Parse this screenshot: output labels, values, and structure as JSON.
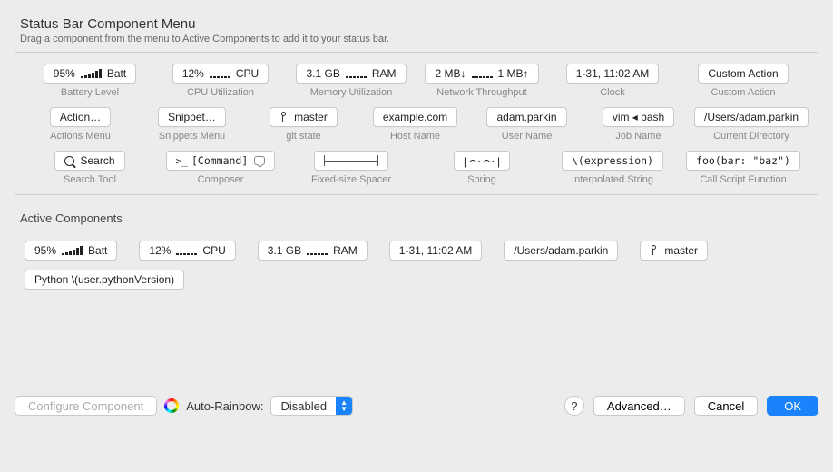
{
  "header": {
    "title": "Status Bar Component Menu",
    "subtitle": "Drag a component from the menu to Active Components to add it to your status bar."
  },
  "menu": [
    [
      {
        "name": "battery-level",
        "caption": "Battery Level",
        "pre": "95%",
        "post": "Batt",
        "bars": "asc"
      },
      {
        "name": "cpu-utilization",
        "caption": "CPU Utilization",
        "pre": "12%",
        "post": "CPU",
        "bars": "flat"
      },
      {
        "name": "memory-utilization",
        "caption": "Memory Utilization",
        "pre": "3.1 GB",
        "post": "RAM",
        "bars": "flat"
      },
      {
        "name": "network-throughput",
        "caption": "Network Throughput",
        "pre": "2 MB↓",
        "post": "1 MB↑",
        "bars": "flat"
      },
      {
        "name": "clock",
        "caption": "Clock",
        "text": "1-31, 11:02 AM"
      },
      {
        "name": "custom-action",
        "caption": "Custom Action",
        "text": "Custom Action"
      }
    ],
    [
      {
        "name": "actions-menu",
        "caption": "Actions Menu",
        "text": "Action…"
      },
      {
        "name": "snippets-menu",
        "caption": "Snippets Menu",
        "text": "Snippet…"
      },
      {
        "name": "git-state",
        "caption": "git state",
        "text": "master",
        "icon": "branch"
      },
      {
        "name": "host-name",
        "caption": "Host Name",
        "text": "example.com"
      },
      {
        "name": "user-name",
        "caption": "User Name",
        "text": "adam.parkin"
      },
      {
        "name": "job-name",
        "caption": "Job Name",
        "text": "vim ◂ bash"
      },
      {
        "name": "current-directory",
        "caption": "Current Directory",
        "text": "/Users/adam.parkin"
      }
    ],
    [
      {
        "name": "search-tool",
        "caption": "Search Tool",
        "text": "Search",
        "icon": "search"
      },
      {
        "name": "composer",
        "caption": "Composer",
        "text": "[Command]",
        "icon": "prompt",
        "trailingIcon": "bubble"
      },
      {
        "name": "fixed-size-spacer",
        "caption": "Fixed-size Spacer",
        "text": "",
        "icon": "spacer"
      },
      {
        "name": "spring",
        "caption": "Spring",
        "text": "|   ～ ～   |"
      },
      {
        "name": "interpolated-string",
        "caption": "Interpolated String",
        "text": "\\(expression)"
      },
      {
        "name": "call-script-function",
        "caption": "Call Script Function",
        "text": "foo(bar: \"baz\")"
      }
    ]
  ],
  "activeLabel": "Active Components",
  "active": [
    {
      "name": "battery-level",
      "pre": "95%",
      "post": "Batt",
      "bars": "asc"
    },
    {
      "name": "cpu-utilization",
      "pre": "12%",
      "post": "CPU",
      "bars": "flat"
    },
    {
      "name": "memory-utilization",
      "pre": "3.1 GB",
      "post": "RAM",
      "bars": "flat"
    },
    {
      "name": "clock",
      "text": "1-31, 11:02 AM"
    },
    {
      "name": "current-directory",
      "text": "/Users/adam.parkin"
    },
    {
      "name": "git-state",
      "text": "master",
      "icon": "branch"
    },
    {
      "name": "python-version",
      "text": "Python \\(user.pythonVersion)"
    }
  ],
  "footer": {
    "configure": "Configure Component",
    "autoRainbowLabel": "Auto-Rainbow:",
    "autoRainbowValue": "Disabled",
    "help": "?",
    "advanced": "Advanced…",
    "cancel": "Cancel",
    "ok": "OK"
  }
}
